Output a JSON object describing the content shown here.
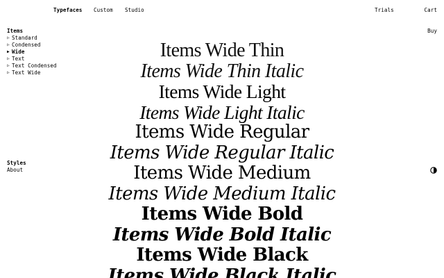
{
  "header": {
    "nav": [
      {
        "label": "Typefaces",
        "active": true
      },
      {
        "label": "Custom",
        "active": false
      },
      {
        "label": "Studio",
        "active": false
      }
    ],
    "trials_label": "Trials",
    "cart_label": "Cart",
    "buy_label": "Buy"
  },
  "sidebar": {
    "family_heading": "Items",
    "families": [
      {
        "label": "Standard",
        "active": false
      },
      {
        "label": "Condensed",
        "active": false
      },
      {
        "label": "Wide",
        "active": true
      },
      {
        "label": "Text",
        "active": false
      },
      {
        "label": "Text Condensed",
        "active": false
      },
      {
        "label": "Text Wide",
        "active": false
      }
    ],
    "styles_label": "Styles",
    "about_label": "About"
  },
  "specimen": {
    "lines": [
      "Items Wide Thin",
      "Items Wide Thin Italic",
      "Items Wide Light",
      "Items Wide Light Italic",
      "Items Wide Regular",
      "Items Wide Regular Italic",
      "Items Wide Medium",
      "Items Wide Medium Italic",
      "Items Wide Bold",
      "Items Wide Bold Italic",
      "Items Wide Black",
      "Items Wide Black Italic"
    ]
  },
  "icons": {
    "theme_toggle": "half-circle-contrast-icon",
    "list_marker": "triangle-right-outline",
    "list_marker_active": "triangle-right-filled"
  },
  "colors": {
    "background": "#ffffff",
    "text": "#000000"
  }
}
